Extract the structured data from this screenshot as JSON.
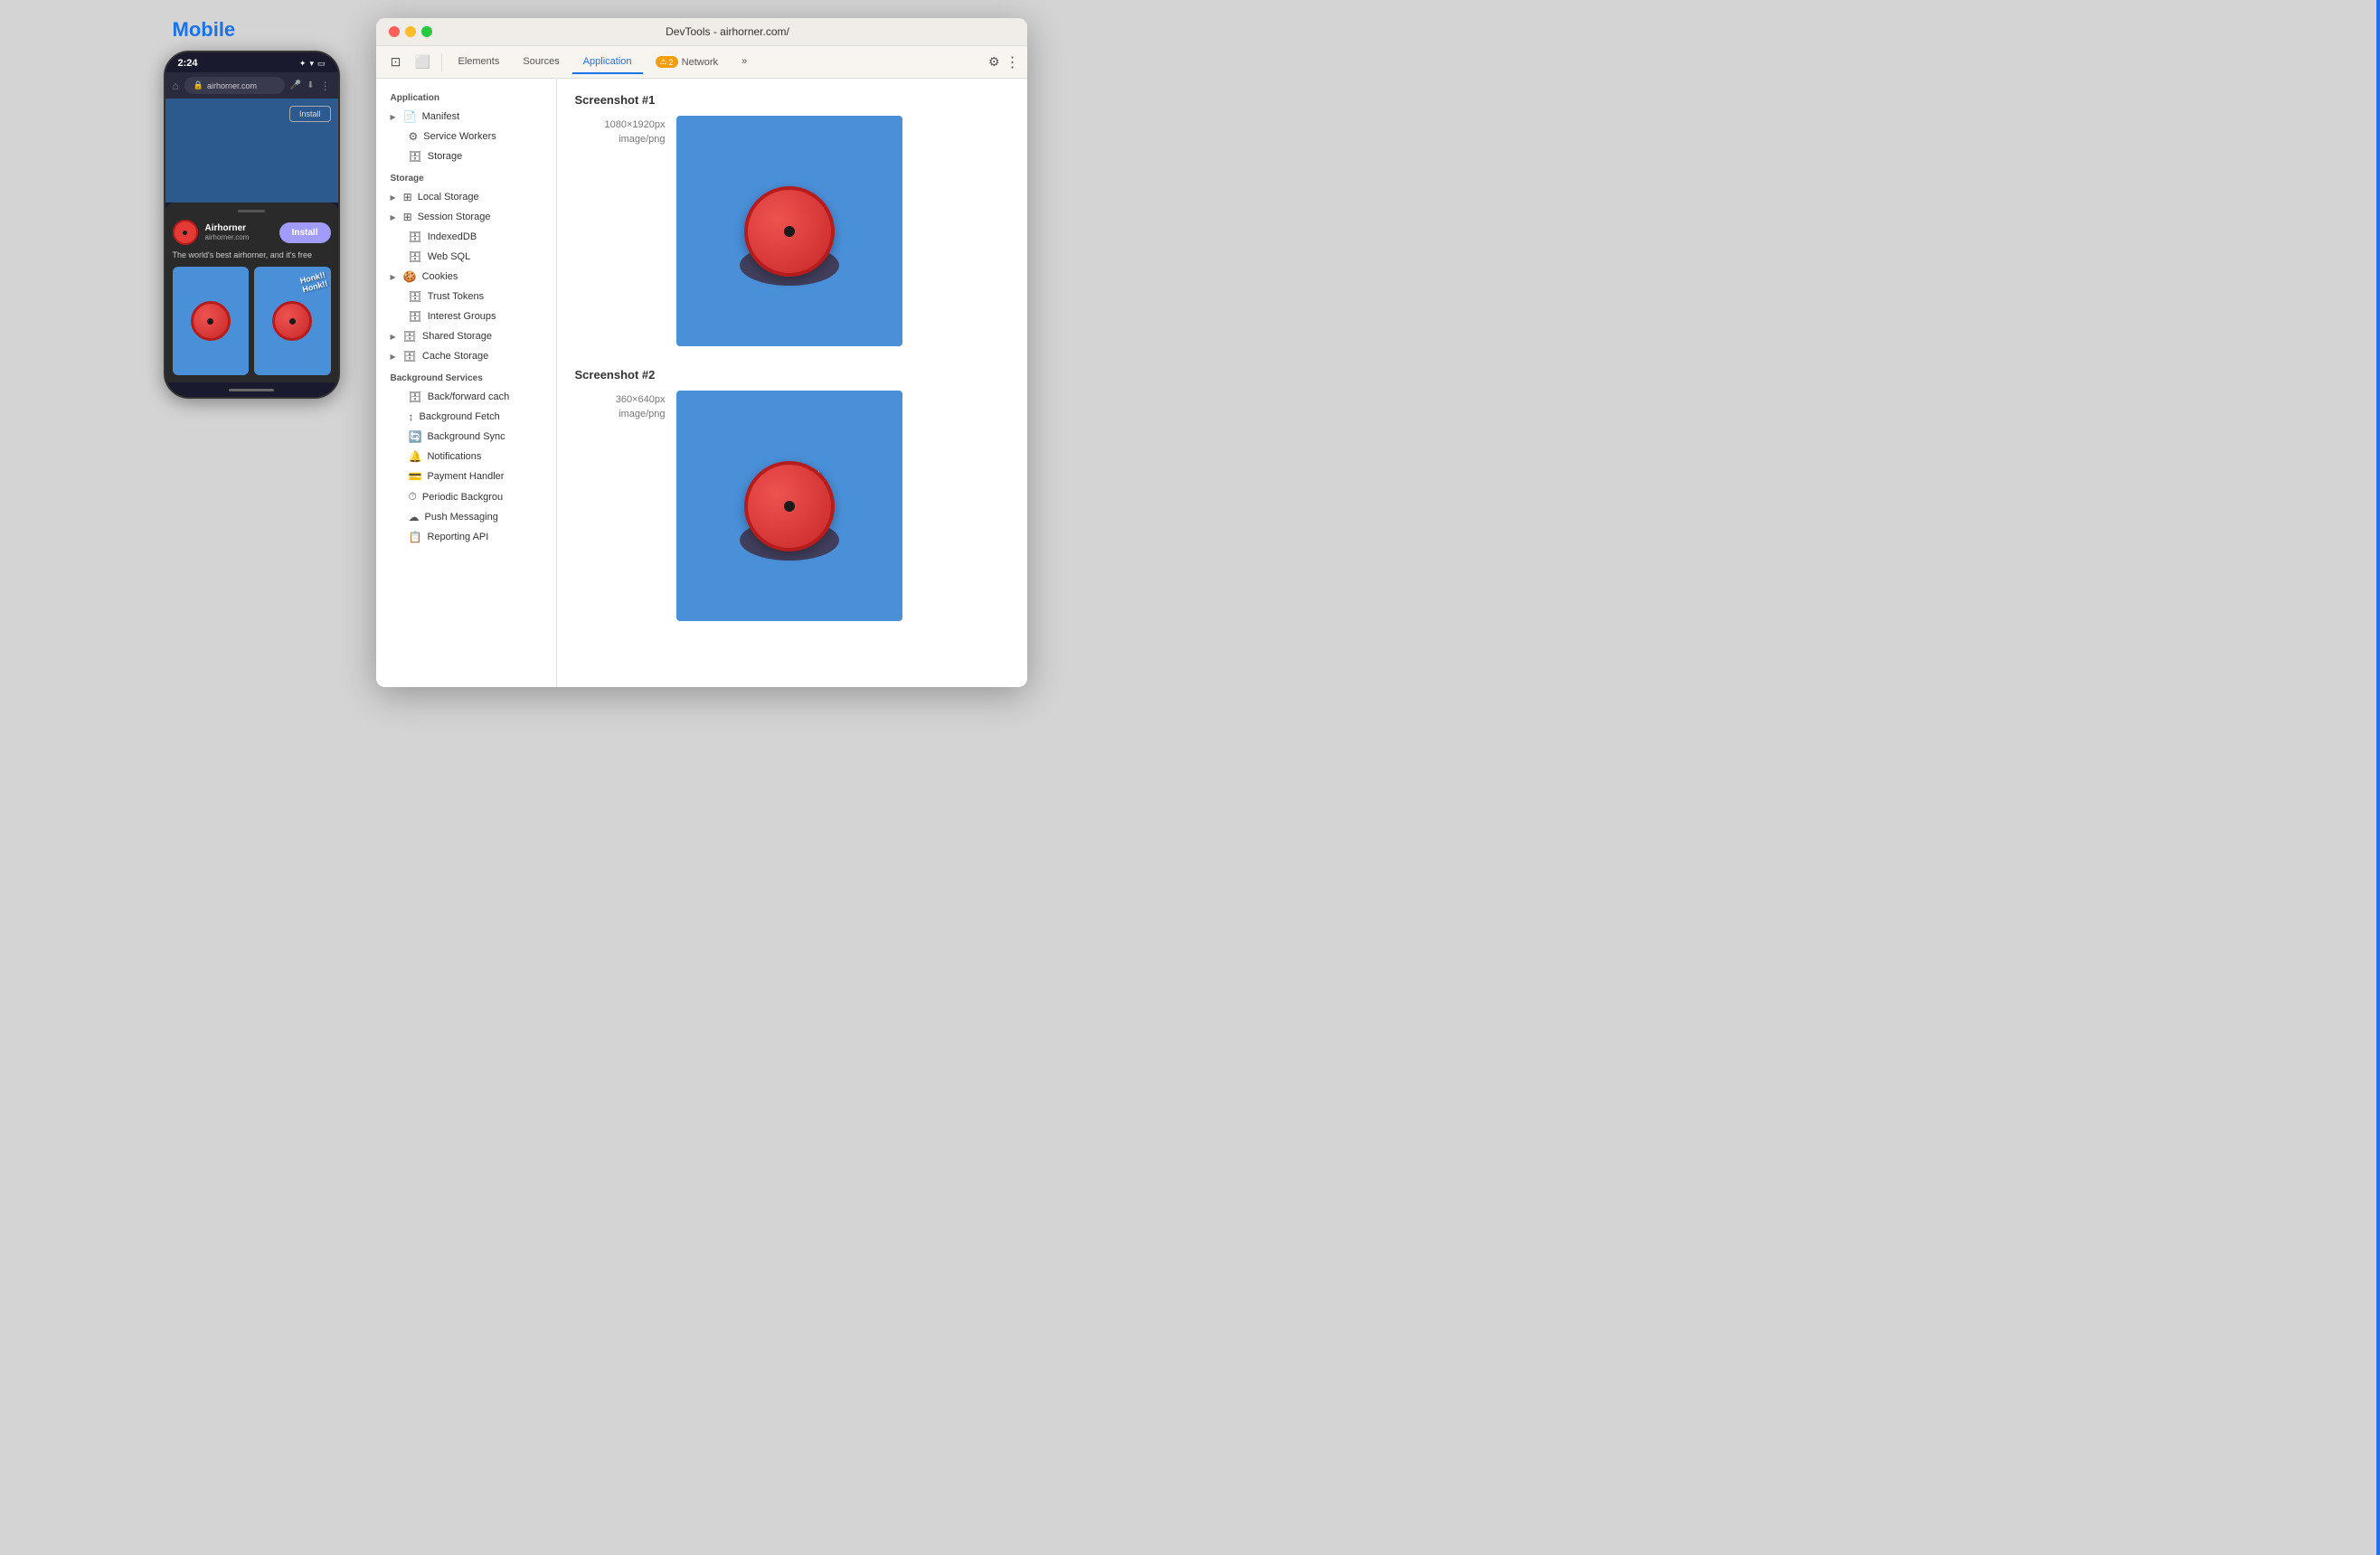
{
  "mobile": {
    "title": "Mobile",
    "time": "2:24",
    "url": "airhorner.com",
    "install_button_top": "Install",
    "app_name": "Airhorner",
    "app_domain": "airhorner.com",
    "install_button_sheet": "Install",
    "app_description": "The world's best airhorner, and it's free",
    "honk_text": "Honk!!\nHonk!!"
  },
  "devtools": {
    "window_title": "DevTools - airhorner.com/",
    "tabs": [
      {
        "label": "Elements",
        "active": false
      },
      {
        "label": "Sources",
        "active": false
      },
      {
        "label": "Application",
        "active": true
      },
      {
        "label": "Network",
        "active": false
      }
    ],
    "warning_count": "2",
    "more_label": "»",
    "sidebar": {
      "sections": [
        {
          "title": "Application",
          "items": [
            {
              "label": "Manifest",
              "icon": "📄",
              "chevron": true,
              "selected": false
            },
            {
              "label": "Service Workers",
              "icon": "⚙️",
              "selected": false
            },
            {
              "label": "Storage",
              "icon": "🗄️",
              "selected": false
            }
          ]
        },
        {
          "title": "Storage",
          "items": [
            {
              "label": "Local Storage",
              "icon": "⊞",
              "chevron": true,
              "selected": false
            },
            {
              "label": "Session Storage",
              "icon": "⊞",
              "chevron": true,
              "selected": false
            },
            {
              "label": "IndexedDB",
              "icon": "🗄️",
              "selected": false
            },
            {
              "label": "Web SQL",
              "icon": "🗄️",
              "selected": false
            },
            {
              "label": "Cookies",
              "icon": "🍪",
              "chevron": true,
              "selected": false
            },
            {
              "label": "Trust Tokens",
              "icon": "🗄️",
              "selected": false
            },
            {
              "label": "Interest Groups",
              "icon": "🗄️",
              "selected": false
            },
            {
              "label": "Shared Storage",
              "icon": "🗄️",
              "chevron": true,
              "selected": false
            },
            {
              "label": "Cache Storage",
              "icon": "🗄️",
              "chevron": true,
              "selected": false
            }
          ]
        },
        {
          "title": "Background Services",
          "items": [
            {
              "label": "Back/forward cache",
              "icon": "🗄️",
              "selected": false
            },
            {
              "label": "Background Fetch",
              "icon": "↕️",
              "selected": false
            },
            {
              "label": "Background Sync",
              "icon": "🔄",
              "selected": false
            },
            {
              "label": "Notifications",
              "icon": "🔔",
              "selected": false
            },
            {
              "label": "Payment Handler",
              "icon": "💳",
              "selected": false
            },
            {
              "label": "Periodic Background",
              "icon": "⏱️",
              "selected": false
            },
            {
              "label": "Push Messaging",
              "icon": "☁️",
              "selected": false
            },
            {
              "label": "Reporting API",
              "icon": "📋",
              "selected": false
            }
          ]
        }
      ]
    },
    "main": {
      "screenshot1": {
        "title": "Screenshot #1",
        "dimensions": "1080×1920px",
        "type": "image/png"
      },
      "screenshot2": {
        "title": "Screenshot #2",
        "dimensions": "360×640px",
        "type": "image/png"
      }
    }
  }
}
